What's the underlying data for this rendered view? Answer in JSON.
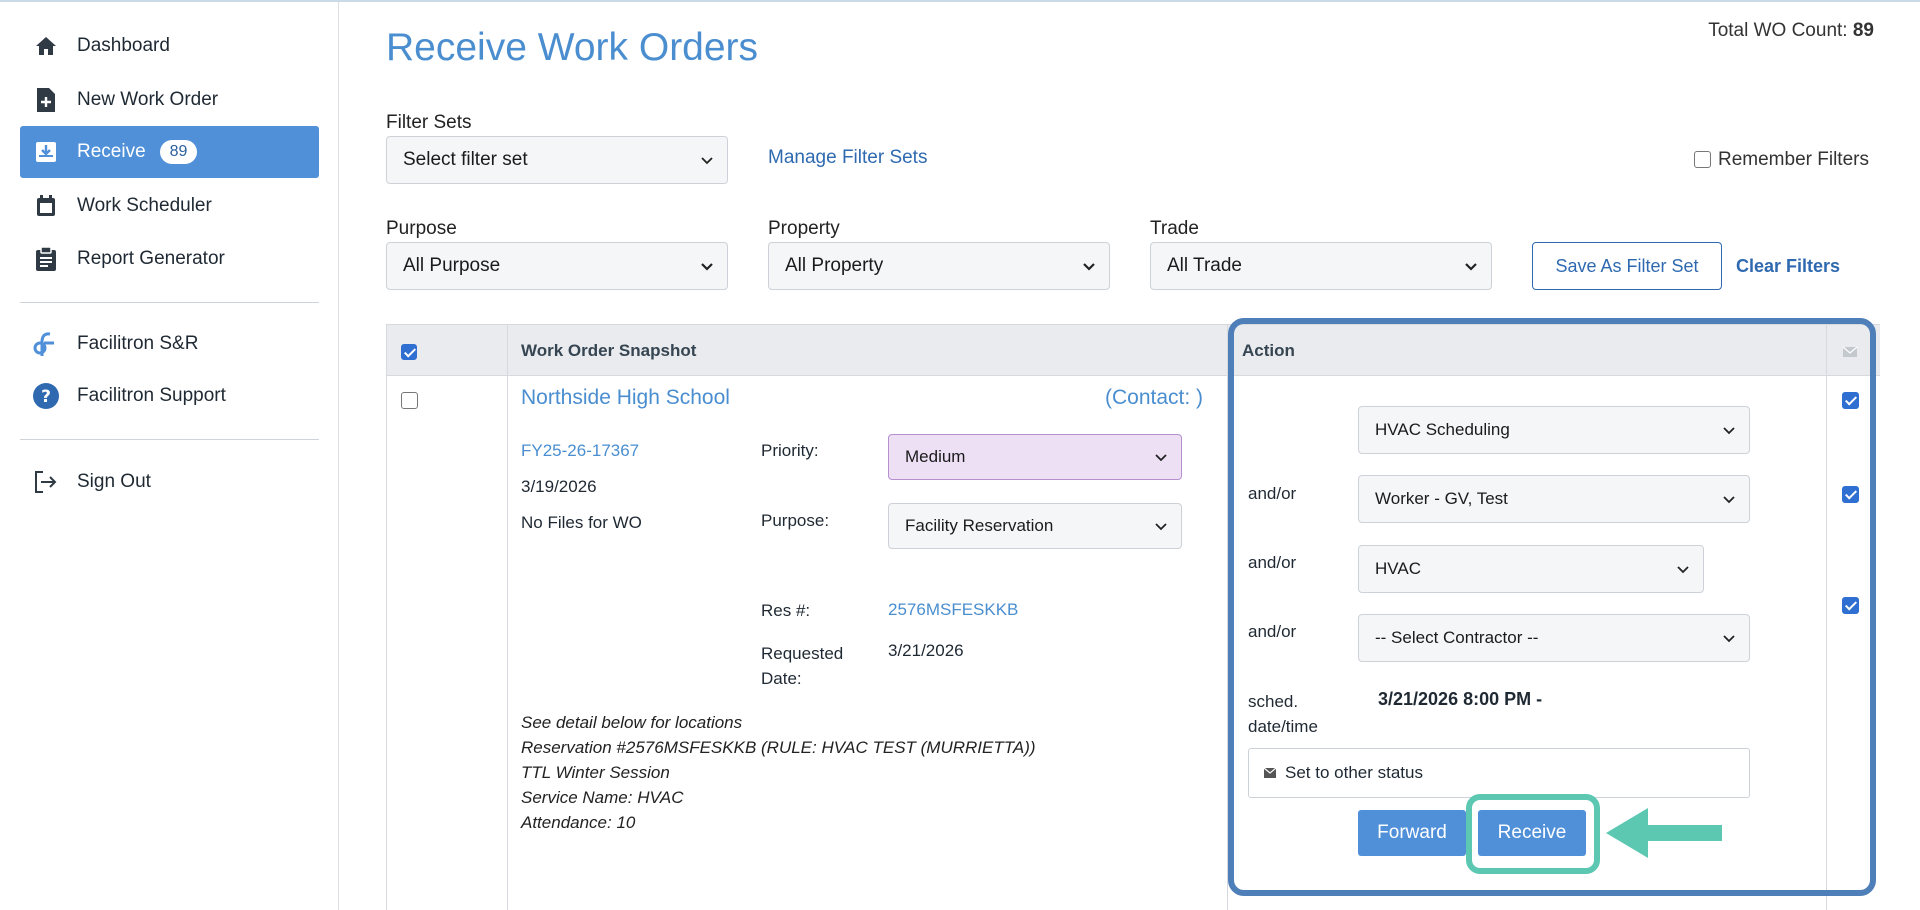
{
  "sidebar": {
    "items": [
      {
        "label": "Dashboard",
        "icon": "home-icon"
      },
      {
        "label": "New Work Order",
        "icon": "file-plus-icon"
      },
      {
        "label": "Receive",
        "icon": "inbox-download-icon",
        "badge": "89"
      },
      {
        "label": "Work Scheduler",
        "icon": "calendar-icon"
      },
      {
        "label": "Report Generator",
        "icon": "clipboard-icon"
      }
    ],
    "links": [
      {
        "label": "Facilitron S&R",
        "icon": "facilitron-logo-icon"
      },
      {
        "label": "Facilitron Support",
        "icon": "question-circle-icon"
      }
    ],
    "sign_out": {
      "label": "Sign Out",
      "icon": "sign-out-icon"
    }
  },
  "page": {
    "title": "Receive Work Orders",
    "total_label": "Total WO Count:",
    "total_value": "89"
  },
  "filters": {
    "filter_sets_label": "Filter Sets",
    "filter_sets_value": "Select filter set",
    "manage_link": "Manage Filter Sets",
    "remember_label": "Remember Filters",
    "purpose_label": "Purpose",
    "purpose_value": "All Purpose",
    "property_label": "Property",
    "property_value": "All Property",
    "trade_label": "Trade",
    "trade_value": "All Trade",
    "save_button": "Save As Filter Set",
    "clear_link": "Clear Filters"
  },
  "table": {
    "col_snapshot": "Work Order Snapshot",
    "col_action": "Action"
  },
  "work_order": {
    "school": "Northside High School",
    "contact": "(Contact: )",
    "number": "FY25-26-17367",
    "date": "3/19/2026",
    "files": "No Files for WO",
    "priority_label": "Priority:",
    "priority_value": "Medium",
    "purpose_label": "Purpose:",
    "purpose_value": "Facility Reservation",
    "res_label": "Res #:",
    "res_value": "2576MSFESKKB",
    "requested_label": "Requested Date:",
    "requested_value": "3/21/2026",
    "details": [
      "See detail below for locations",
      "Reservation #2576MSFESKKB (RULE: HVAC TEST (MURRIETTA))",
      "TTL Winter Session",
      "Service Name: HVAC",
      "Attendance: 10"
    ]
  },
  "action": {
    "scheduling_value": "HVAC Scheduling",
    "andor_label": "and/or",
    "worker_value": "Worker - GV, Test",
    "trade_value": "HVAC",
    "contractor_value": "-- Select Contractor --",
    "sched_label": "sched. date/time",
    "sched_value": "3/21/2026 8:00 PM -",
    "status_label": "Set to other status",
    "forward_button": "Forward",
    "receive_button": "Receive"
  },
  "colors": {
    "accent": "#4f90d9",
    "highlight_frame": "#4f7fb8",
    "teal_callout": "#5cc8b2",
    "priority_bg": "#ede0f5"
  }
}
